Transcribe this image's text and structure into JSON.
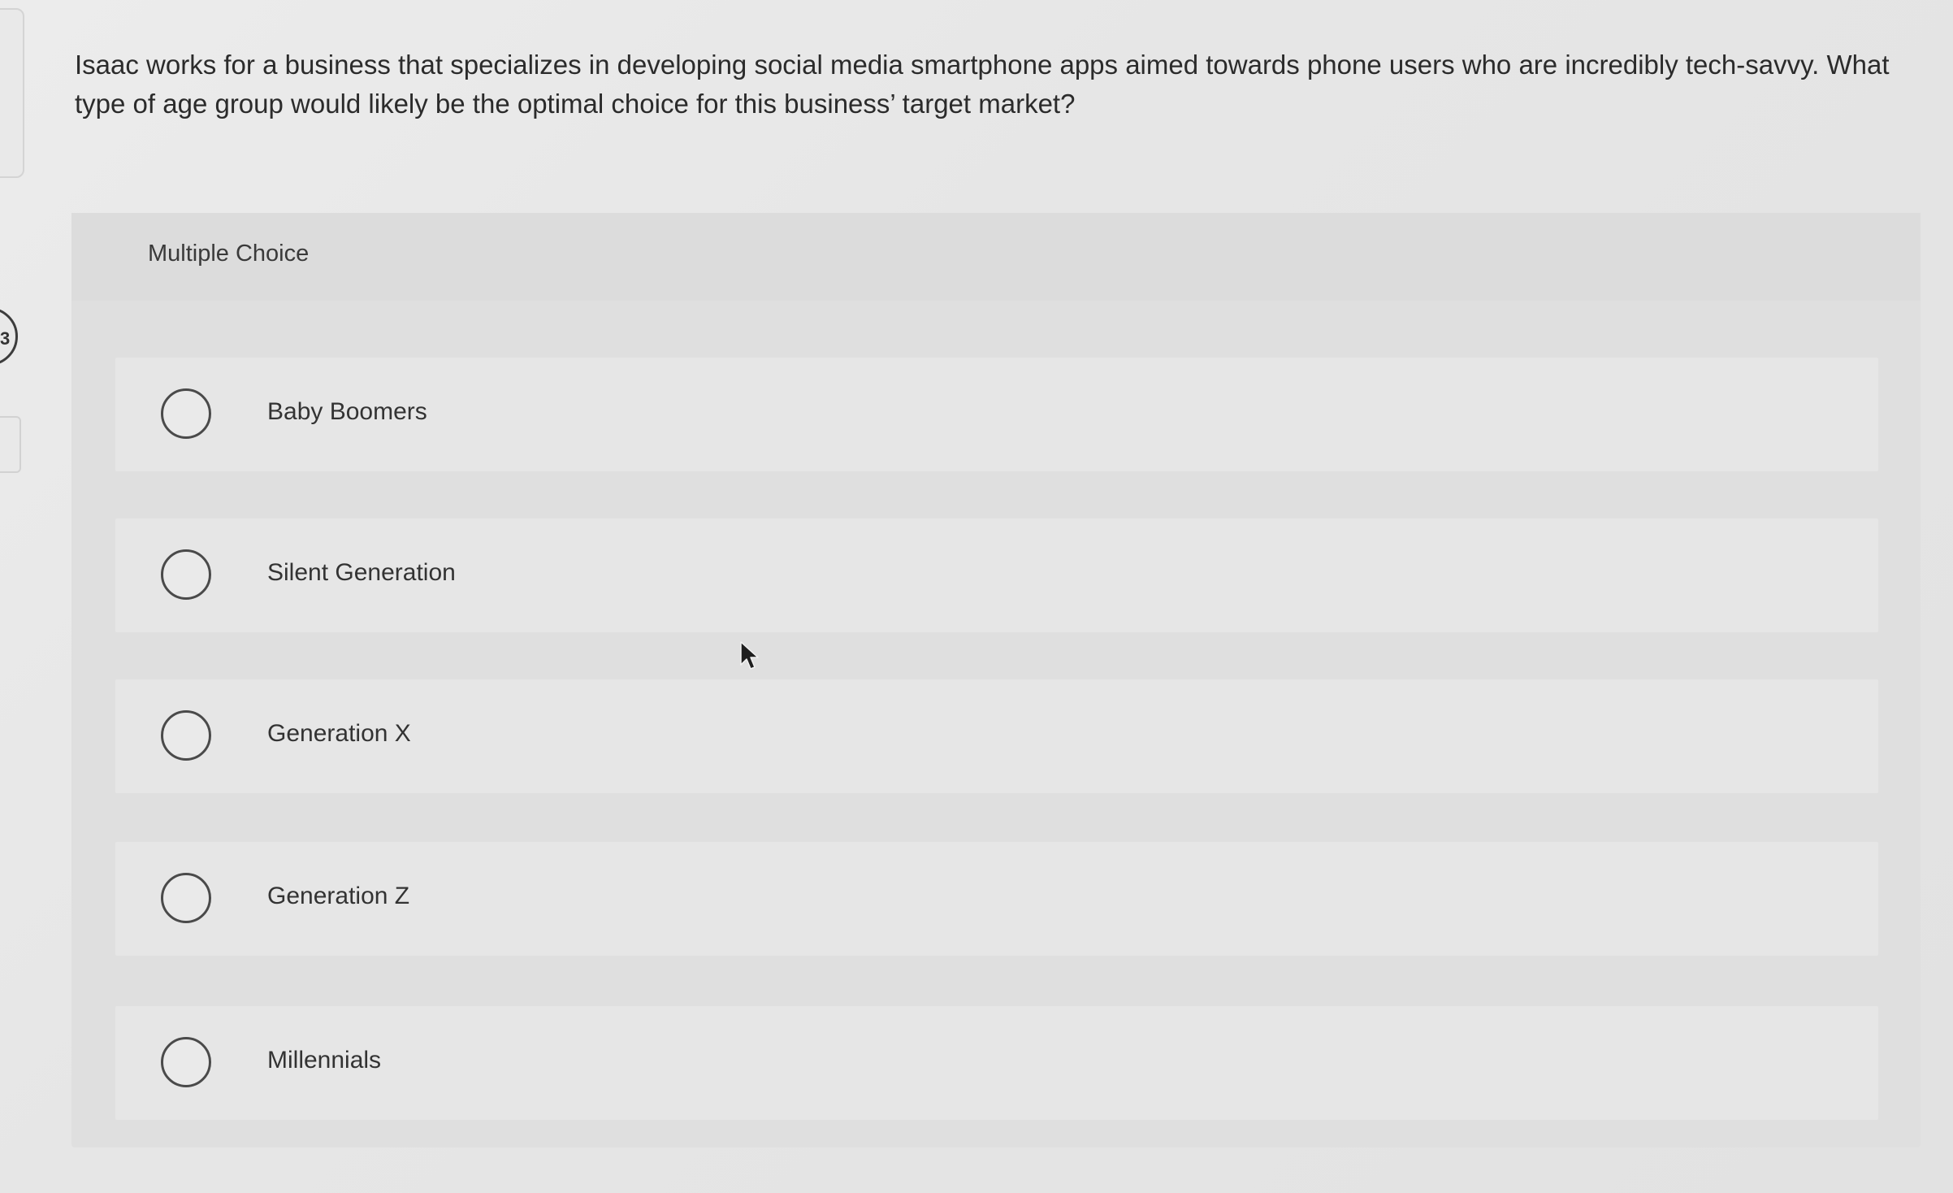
{
  "question": {
    "text": "Isaac works for a business that specializes in developing social media smartphone apps aimed towards phone users who are incredibly tech-savvy. What type of age group would likely be the optimal choice for this business’ target market?"
  },
  "panel": {
    "header_label": "Multiple Choice"
  },
  "edge": {
    "number_fragment": "3"
  },
  "options": [
    {
      "label": "Baby Boomers",
      "selected": false
    },
    {
      "label": "Silent Generation",
      "selected": false
    },
    {
      "label": "Generation X",
      "selected": false
    },
    {
      "label": "Generation Z",
      "selected": false
    },
    {
      "label": "Millennials",
      "selected": false
    }
  ],
  "icons": {
    "radio": "radio-unchecked-icon",
    "cursor": "mouse-pointer-icon"
  },
  "colors": {
    "background": "#e6e6e6",
    "panel": "#dfdfdf",
    "option_row": "#e6e6e6",
    "text": "#2b2b2b",
    "radio_border": "#4a4a4a"
  }
}
